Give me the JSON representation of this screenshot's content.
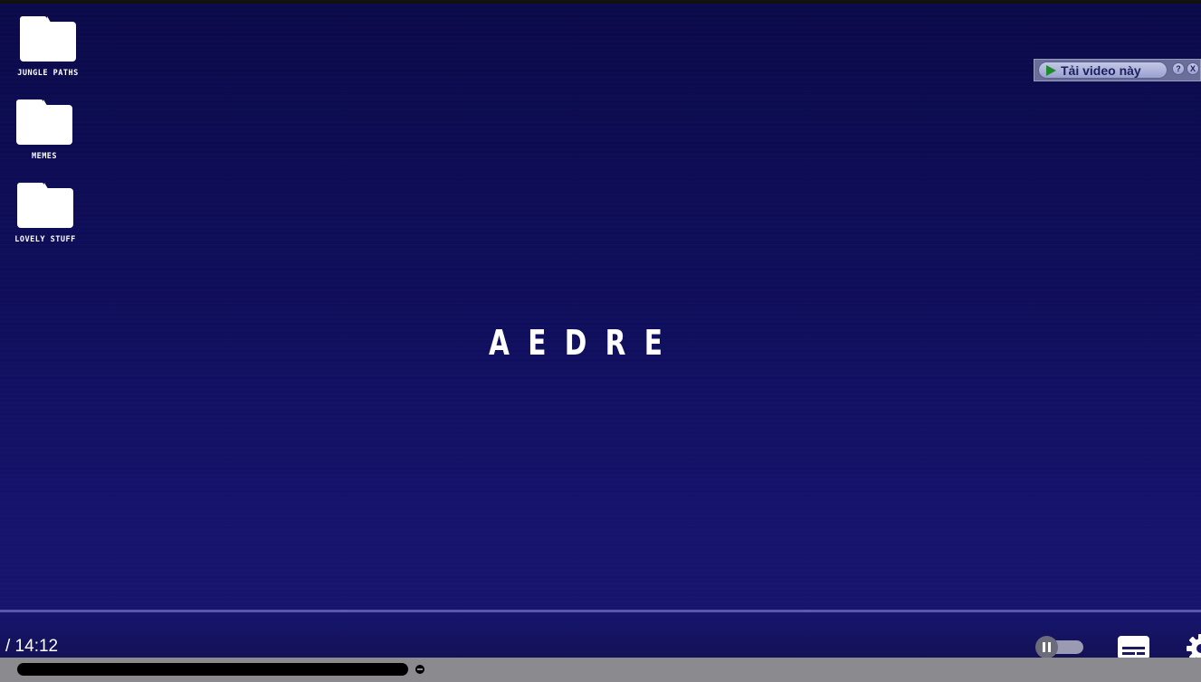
{
  "desktop": {
    "folders": [
      {
        "label": "JUNGLE PATHS"
      },
      {
        "label": "MEMES"
      },
      {
        "label": "LOVELY STUFF"
      }
    ]
  },
  "video": {
    "title_text": "AEDRE"
  },
  "download_bar": {
    "button_label": "Tải video này",
    "help_label": "?",
    "close_label": "X",
    "play_icon": "play-triangle-icon",
    "accent_color": "#1f8a2e"
  },
  "controls": {
    "time_text": "/ 14:12",
    "autoplay_state": "on",
    "captions_icon": "subtitles-icon",
    "settings_icon": "gear-icon"
  },
  "colors": {
    "background_top": "#0b0a4a",
    "background_bottom": "#18166f",
    "progress_line": "#5b5aa8"
  }
}
